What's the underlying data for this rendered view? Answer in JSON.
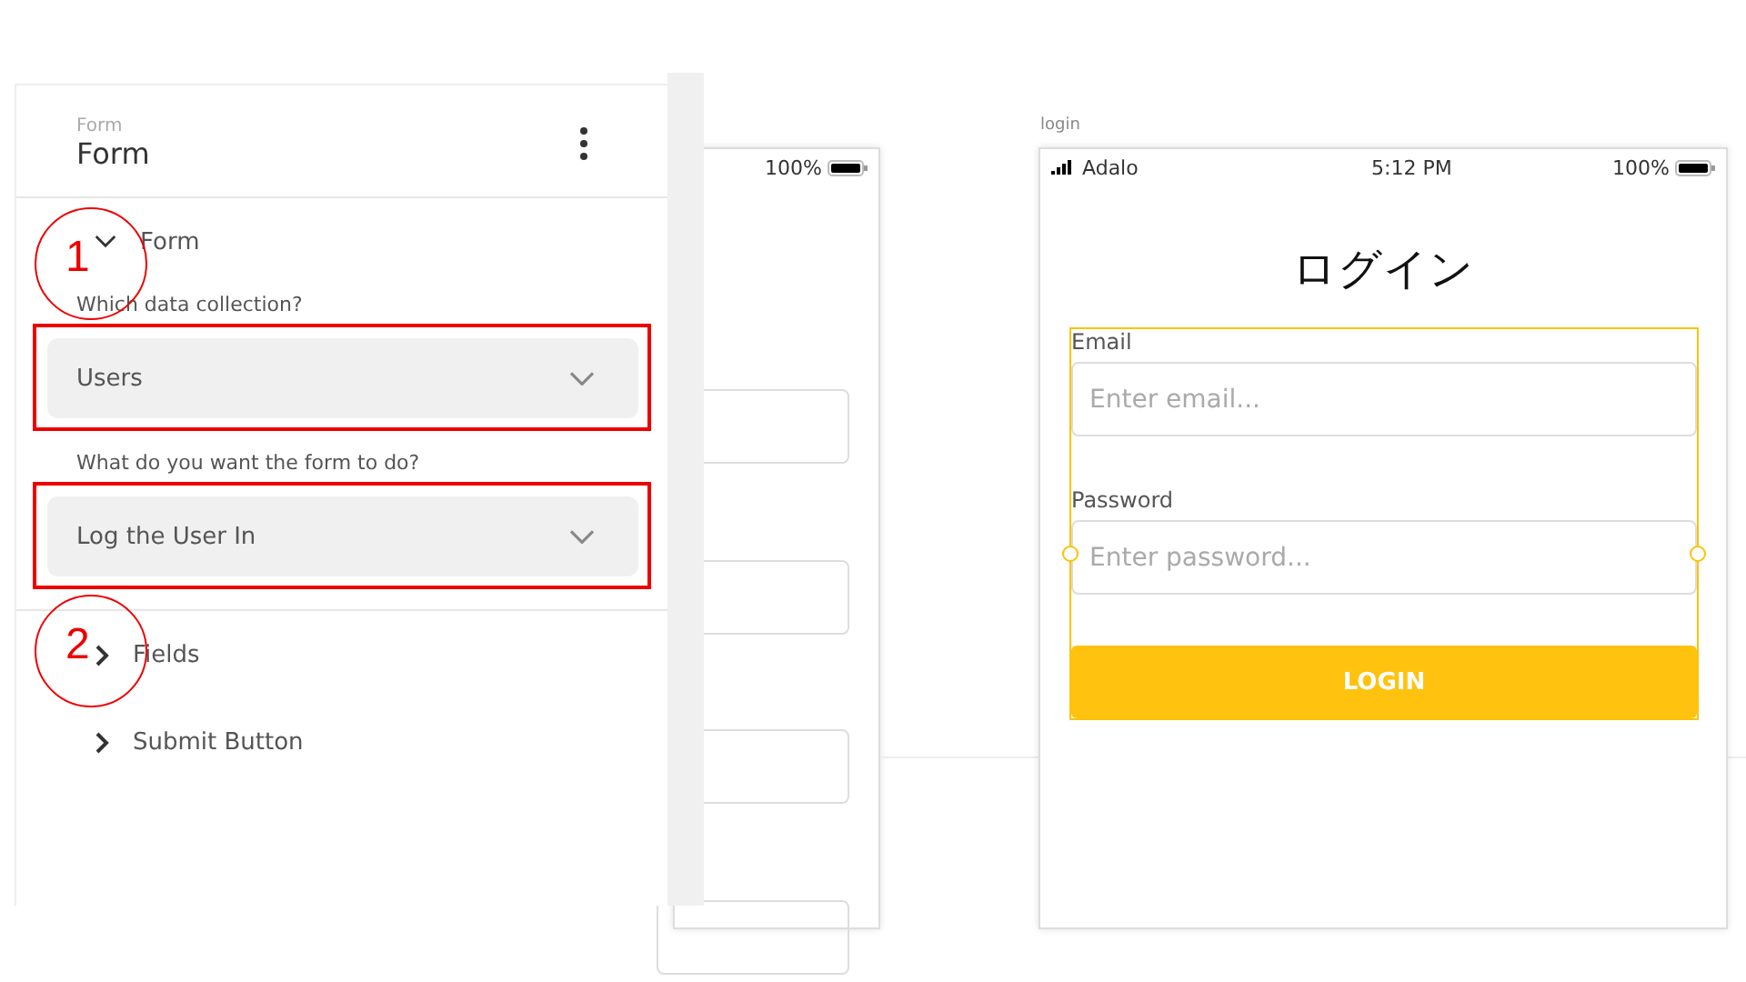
{
  "panel": {
    "subtitle": "Form",
    "title": "Form",
    "sections": [
      {
        "label": "Form",
        "expanded": true,
        "fields": [
          {
            "label": "Which data collection?",
            "value": "Users",
            "highlighted": true
          },
          {
            "label": "What do you want the form to do?",
            "value": "Log the User In",
            "highlighted": true
          }
        ]
      },
      {
        "label": "Fields",
        "expanded": false
      },
      {
        "label": "Submit Button",
        "expanded": false
      }
    ]
  },
  "annotations": [
    {
      "number": "1"
    },
    {
      "number": "2"
    }
  ],
  "canvas": {
    "left_screen": {
      "battery": "100%",
      "inputs": [
        {
          "kind": "input"
        },
        {
          "kind": "input"
        },
        {
          "kind": "input"
        },
        {
          "kind": "input"
        }
      ]
    },
    "right_screen": {
      "name": "login",
      "carrier": "Adalo",
      "time": "5:12 PM",
      "battery": "100%",
      "title": "ログイン",
      "form": {
        "selected": true,
        "fields": [
          {
            "label": "Email",
            "placeholder": "Enter email..."
          },
          {
            "label": "Password",
            "placeholder": "Enter password..."
          }
        ],
        "button": "LOGIN"
      }
    }
  }
}
